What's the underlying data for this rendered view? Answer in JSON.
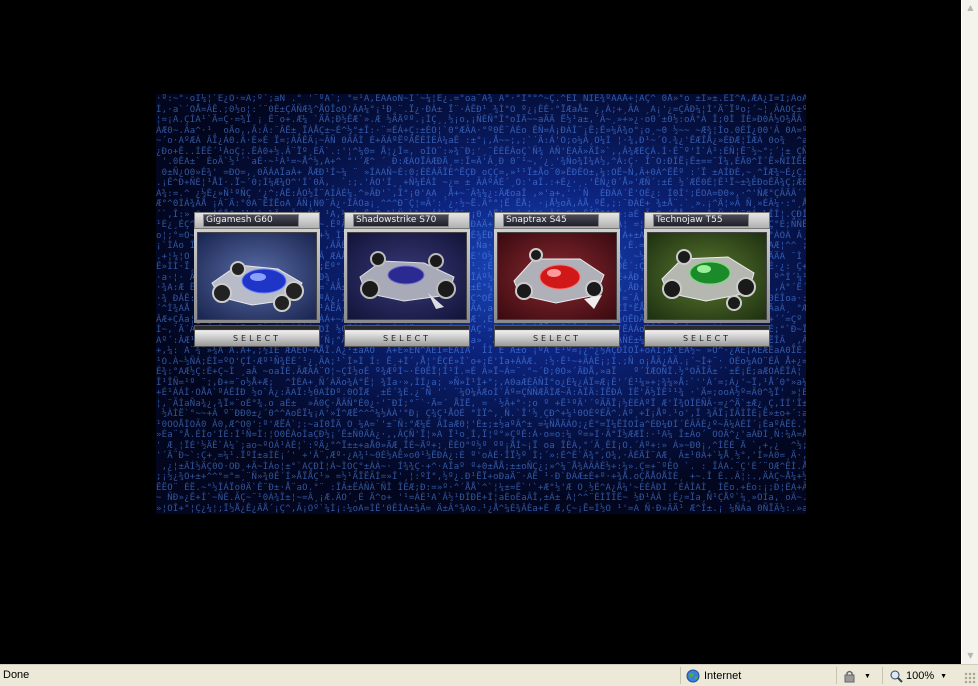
{
  "game": {
    "cars": [
      {
        "name": "Gigamesh G60",
        "select_label": "SELECT",
        "bg": "#243a7a",
        "body": "#1e35c8"
      },
      {
        "name": "Shadowstrike S70",
        "select_label": "SELECT",
        "bg": "#1c2460",
        "body": "#2a2a90"
      },
      {
        "name": "Snaptrax S45",
        "select_label": "SELECT",
        "bg": "#6a1418",
        "body": "#d01818"
      },
      {
        "name": "Technojaw T55",
        "select_label": "SELECT",
        "bg": "#2e5018",
        "body": "#1a8a2a"
      }
    ]
  },
  "statusbar": {
    "status": "Done",
    "zone": "Internet",
    "zoom": "100%"
  },
  "icons": {
    "zone": "globe-icon",
    "protected_mode": "lock-icon",
    "zoom": "magnifier-icon"
  }
}
